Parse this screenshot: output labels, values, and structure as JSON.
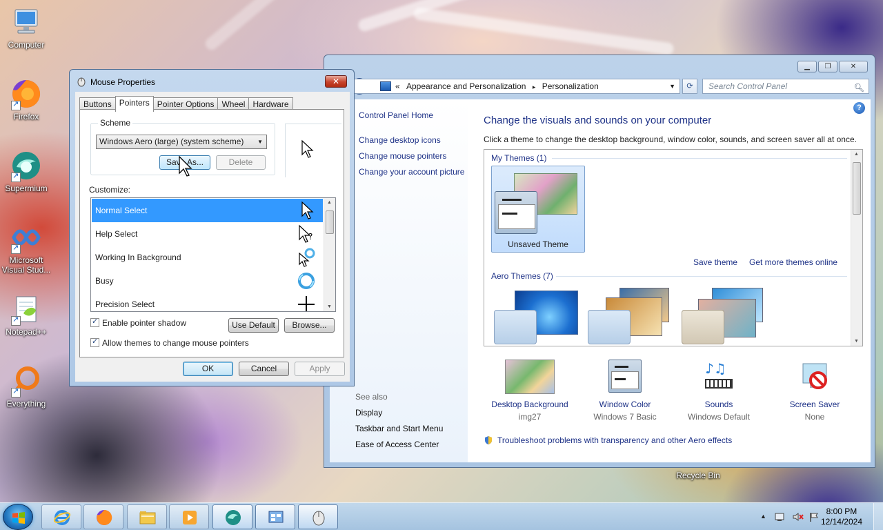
{
  "desktop": {
    "icons": [
      {
        "label": "Computer"
      },
      {
        "label": "Firefox"
      },
      {
        "label": "Supermium"
      },
      {
        "label": "Microsoft Visual Stud..."
      },
      {
        "label": "Notepad++"
      },
      {
        "label": "Everything"
      }
    ],
    "recycle_bin": "Recycle Bin"
  },
  "control_panel": {
    "breadcrumb": {
      "prefix": "«",
      "part1": "Appearance and Personalization",
      "sep": "▸",
      "part2": "Personalization"
    },
    "search_placeholder": "Search Control Panel",
    "left_links": {
      "home": "Control Panel Home",
      "desktop_icons": "Change desktop icons",
      "mouse_pointers": "Change mouse pointers",
      "account_picture": "Change your account picture"
    },
    "see_also": {
      "header": "See also",
      "items": [
        "Display",
        "Taskbar and Start Menu",
        "Ease of Access Center"
      ]
    },
    "heading": "Change the visuals and sounds on your computer",
    "subheading": "Click a theme to change the desktop background, window color, sounds, and screen saver all at once.",
    "my_themes_label": "My Themes (1)",
    "unsaved_theme": "Unsaved Theme",
    "save_theme": "Save theme",
    "get_more": "Get more themes online",
    "aero_themes_label": "Aero Themes (7)",
    "bottom": [
      {
        "title": "Desktop Background",
        "sub": "img27"
      },
      {
        "title": "Window Color",
        "sub": "Windows 7 Basic"
      },
      {
        "title": "Sounds",
        "sub": "Windows Default"
      },
      {
        "title": "Screen Saver",
        "sub": "None"
      }
    ],
    "troubleshoot": "Troubleshoot problems with transparency and other Aero effects"
  },
  "mouse_props": {
    "title": "Mouse Properties",
    "tabs": [
      "Buttons",
      "Pointers",
      "Pointer Options",
      "Wheel",
      "Hardware"
    ],
    "scheme_label": "Scheme",
    "scheme_value": "Windows Aero (large) (system scheme)",
    "save_as": "Save As...",
    "delete": "Delete",
    "customize_label": "Customize:",
    "list": [
      "Normal Select",
      "Help Select",
      "Working In Background",
      "Busy",
      "Precision Select"
    ],
    "enable_shadow": "Enable pointer shadow",
    "use_default": "Use Default",
    "browse": "Browse...",
    "allow_themes": "Allow themes to change mouse pointers",
    "ok": "OK",
    "cancel": "Cancel",
    "apply": "Apply"
  },
  "taskbar": {
    "time": "8:00 PM",
    "date": "12/14/2024"
  }
}
